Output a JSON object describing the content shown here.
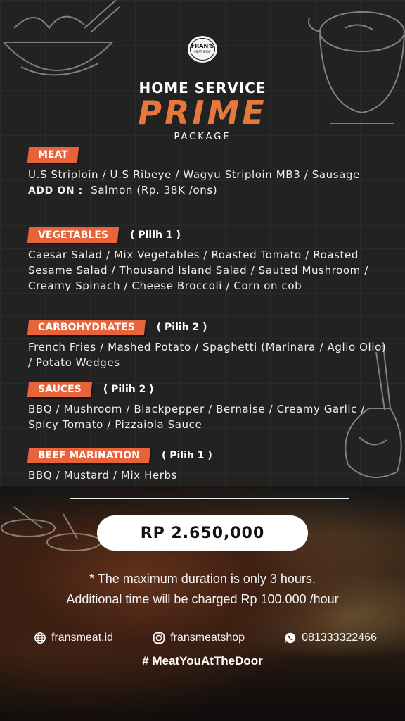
{
  "brand": {
    "logo_text": "FRAN'S",
    "logo_sub": "MEAT SHOP"
  },
  "header": {
    "headline": "HOME SERVICE",
    "title": "PRIME",
    "subtitle": "PACKAGE"
  },
  "sections": {
    "meat": {
      "label": "MEAT",
      "items": "U.S Striploin / U.S Ribeye / Wagyu Striploin MB3 / Sausage",
      "addon_label": "ADD ON :",
      "addon_value": "Salmon (Rp. 38K /ons)"
    },
    "vegetables": {
      "label": "VEGETABLES",
      "note": "( Pilih 1 )",
      "items": "Caesar Salad / Mix Vegetables / Roasted Tomato / Roasted Sesame Salad / Thousand Island Salad / Sauted Mushroom / Creamy Spinach / Cheese Broccoli / Corn on cob"
    },
    "carbohydrates": {
      "label": "CARBOHYDRATES",
      "note": "( Pilih 2 )",
      "items": "French Fries / Mashed Potato / Spaghetti (Marinara / Aglio Olio) / Potato Wedges"
    },
    "sauces": {
      "label": "SAUCES",
      "note": "( Pilih 2 )",
      "items": "BBQ / Mushroom / Blackpepper / Bernaise / Creamy Garlic / Spicy Tomato / Pizzaiola Sauce"
    },
    "beef_marination": {
      "label": "BEEF MARINATION",
      "note": "( Pilih 1 )",
      "items": "BBQ / Mustard / Mix Herbs"
    }
  },
  "price": "RP  2.650,000",
  "disclaimer": {
    "line1": "* The maximum duration is only 3 hours.",
    "line2": "Additional time will be charged Rp 100.000 /hour"
  },
  "contacts": {
    "website": "fransmeat.id",
    "instagram": "fransmeatshop",
    "whatsapp": "081333322466"
  },
  "hashtag": "# MeatYouAtTheDoor",
  "colors": {
    "accent": "#e8773a",
    "pill": "#e8633a",
    "background": "#1c1c1c"
  }
}
